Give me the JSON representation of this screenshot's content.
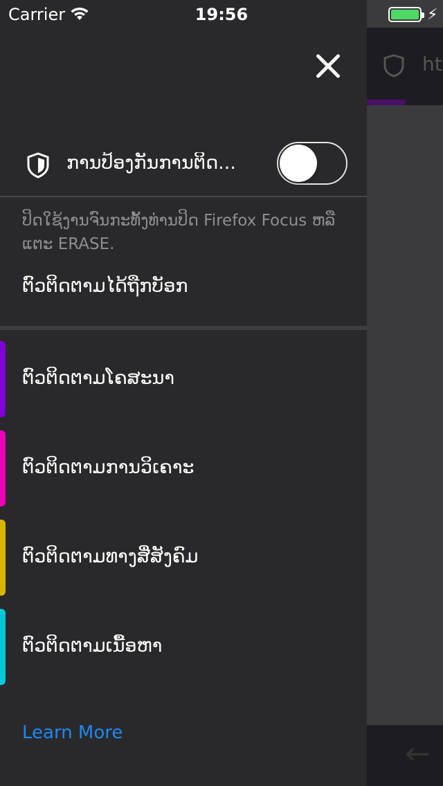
{
  "status_bar": {
    "carrier": "Carrier",
    "time": "19:56"
  },
  "background": {
    "url_fragment": "ht"
  },
  "panel": {
    "tracking_protection_label": "ການປ້ອງກັນການຕິດ...",
    "tracking_protection_enabled": false,
    "description": "ປິດໃຊ້ງານຈົນກະທັ້ງທ່ານປິດ Firefox Focus ຫລື ແຕະ ERASE.",
    "trackers_blocked_label": "ຕົວຕິດຕາມໄດ້ຖືກບັອກ",
    "categories": [
      {
        "label": "ຕົວຕິດຕາມໂຄສະນາ",
        "color": "#8000d7"
      },
      {
        "label": "ຕົວຕິດຕາມການວິເຄາະ",
        "color": "#ed00b5"
      },
      {
        "label": "ຕົວຕິດຕາມທາງສື່ສັງຄົມ",
        "color": "#d7b600"
      },
      {
        "label": "ຕົວຕິດຕາມເນື້ອຫາ",
        "color": "#00c8d7"
      }
    ],
    "learn_more": "Learn More"
  },
  "colors": {
    "panel_bg": "#29292b",
    "link": "#1e88f0"
  },
  "icons": [
    "wifi-icon",
    "battery-icon",
    "charging-icon",
    "close-icon",
    "shield-icon",
    "back-arrow-icon"
  ]
}
